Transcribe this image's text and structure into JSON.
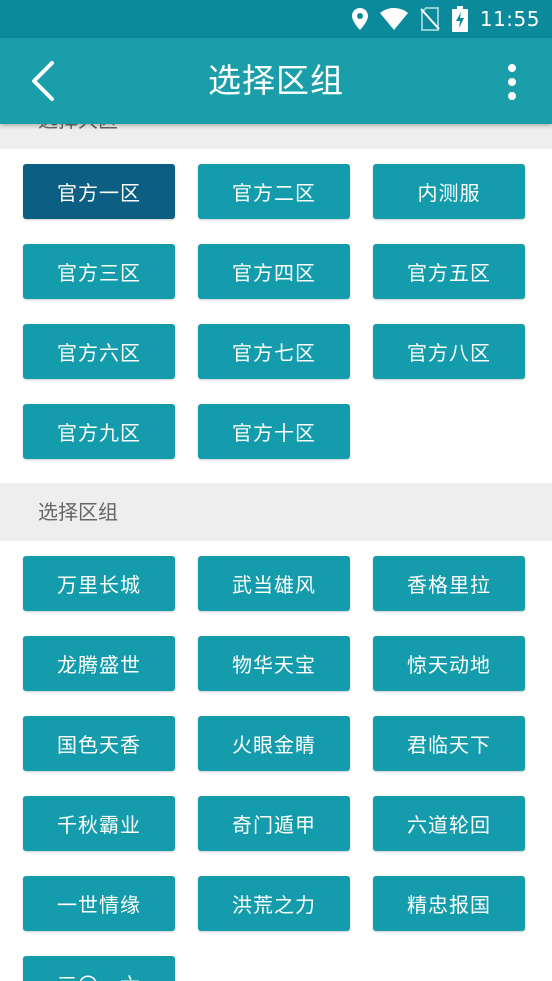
{
  "status_bar": {
    "time": "11:55",
    "icons": [
      "location-icon",
      "wifi-icon",
      "no-sim-icon",
      "battery-charging-icon"
    ]
  },
  "app_bar": {
    "title": "选择区组",
    "back_icon": "back-arrow-icon",
    "menu_icon": "more-vert-icon"
  },
  "server_section": {
    "header_label": "选择大区",
    "selected_index": 0,
    "items": [
      "官方一区",
      "官方二区",
      "内测服",
      "官方三区",
      "官方四区",
      "官方五区",
      "官方六区",
      "官方七区",
      "官方八区",
      "官方九区",
      "官方十区"
    ]
  },
  "group_section": {
    "header_label": "选择区组",
    "items": [
      "万里长城",
      "武当雄风",
      "香格里拉",
      "龙腾盛世",
      "物华天宝",
      "惊天动地",
      "国色天香",
      "火眼金睛",
      "君临天下",
      "千秋霸业",
      "奇门遁甲",
      "六道轮回",
      "一世情缘",
      "洪荒之力",
      "精忠报国",
      "三〇一六"
    ]
  },
  "colors": {
    "status_bar": "#0a8a9b",
    "app_bar": "#1a9faa",
    "button": "#149cac",
    "button_selected": "#0c5e82",
    "section_header_bg": "#eeeeee"
  }
}
